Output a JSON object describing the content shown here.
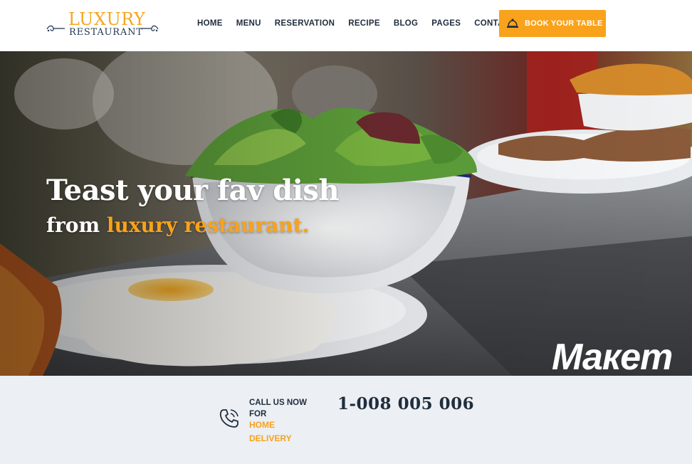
{
  "header": {
    "logo": {
      "top": "LUXURY",
      "bottom": "RESTAURANT"
    },
    "nav": [
      "HOME",
      "MENU",
      "RESERVATION",
      "RECIPE",
      "BLOG",
      "PAGES",
      "CONTACT"
    ],
    "book_button": {
      "label": "BOOK YOUR TABLE",
      "icon": "bell-icon"
    }
  },
  "hero": {
    "title": "Teast your fav dish",
    "subtitle_prefix": "from ",
    "subtitle_highlight": "luxury restaurant."
  },
  "watermark": "Макет",
  "contact_strip": {
    "icon": "phone-icon",
    "call_label": "CALL US NOW FOR",
    "delivery_label": "HOME DELIVERY",
    "phone_number": "1-008 005 006"
  },
  "colors": {
    "accent": "#f9a21b",
    "dark_text": "#1f2d3d",
    "strip_bg": "#eceff3"
  }
}
